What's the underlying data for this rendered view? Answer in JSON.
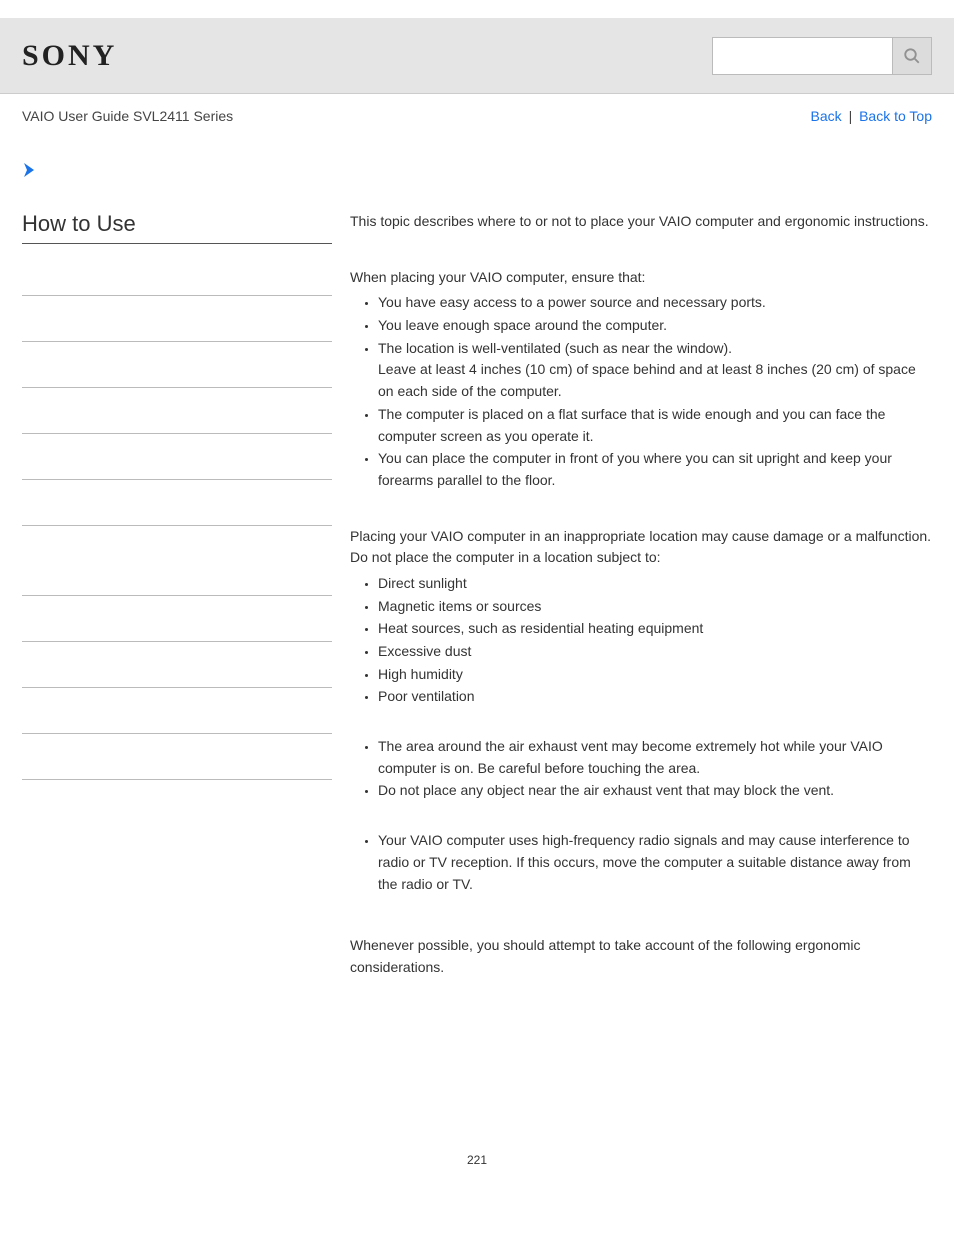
{
  "header": {
    "logo": "SONY",
    "search_placeholder": ""
  },
  "subheader": {
    "breadcrumb": "VAIO User Guide SVL2411 Series",
    "back_label": "Back",
    "top_label": "Back to Top"
  },
  "sidebar": {
    "title": "How to Use"
  },
  "content": {
    "intro": "This topic describes where to or not to place your VAIO computer and ergonomic instructions.",
    "sec1_intro": "When placing your VAIO computer, ensure that:",
    "sec1_items": [
      "You have easy access to a power source and necessary ports.",
      "You leave enough space around the computer.",
      "The location is well-ventilated (such as near the window).\nLeave at least 4 inches (10 cm) of space behind and at least 8 inches (20 cm) of space on each side of the computer.",
      "The computer is placed on a flat surface that is wide enough and you can face the computer screen as you operate it.",
      "You can place the computer in front of you where you can sit upright and keep your forearms parallel to the floor."
    ],
    "sec2_intro": "Placing your VAIO computer in an inappropriate location may cause damage or a malfunction. Do not place the computer in a location subject to:",
    "sec2_items": [
      "Direct sunlight",
      "Magnetic items or sources",
      "Heat sources, such as residential heating equipment",
      "Excessive dust",
      "High humidity",
      "Poor ventilation"
    ],
    "sec3_items": [
      "The area around the air exhaust vent may become extremely hot while your VAIO computer is on. Be careful before touching the area.",
      "Do not place any object near the air exhaust vent that may block the vent."
    ],
    "sec4_items": [
      "Your VAIO computer uses high-frequency radio signals and may cause interference to radio or TV reception. If this occurs, move the computer a suitable distance away from the radio or TV."
    ],
    "sec5": "Whenever possible, you should attempt to take account of the following ergonomic considerations.",
    "page_number": "221"
  }
}
